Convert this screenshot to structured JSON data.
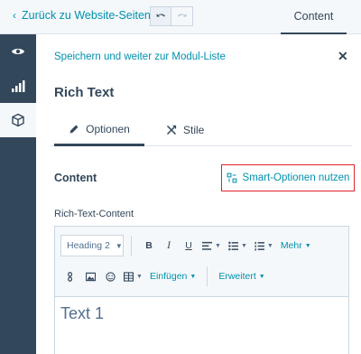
{
  "header": {
    "back_label": "Zurück zu Website-Seiten",
    "content_tab": "Content"
  },
  "panel": {
    "save_link": "Speichern und weiter zur Modul-Liste",
    "module_title": "Rich Text",
    "tabs": [
      {
        "label": "Optionen",
        "icon": "pencil-icon",
        "active": true
      },
      {
        "label": "Stile",
        "icon": "styles-icon",
        "active": false
      }
    ],
    "section_title": "Content",
    "smart_button": "Smart-Optionen nutzen",
    "field_label": "Rich-Text-Content"
  },
  "editor": {
    "heading_select": "Heading 2",
    "more_label": "Mehr",
    "insert_label": "Einfügen",
    "advanced_label": "Erweitert",
    "bold": "B",
    "italic": "I",
    "underline": "U",
    "body_text": "Text 1"
  },
  "colors": {
    "link": "#0091ae",
    "text": "#33475b",
    "rail": "#33475b",
    "highlight": "#e0242a"
  }
}
